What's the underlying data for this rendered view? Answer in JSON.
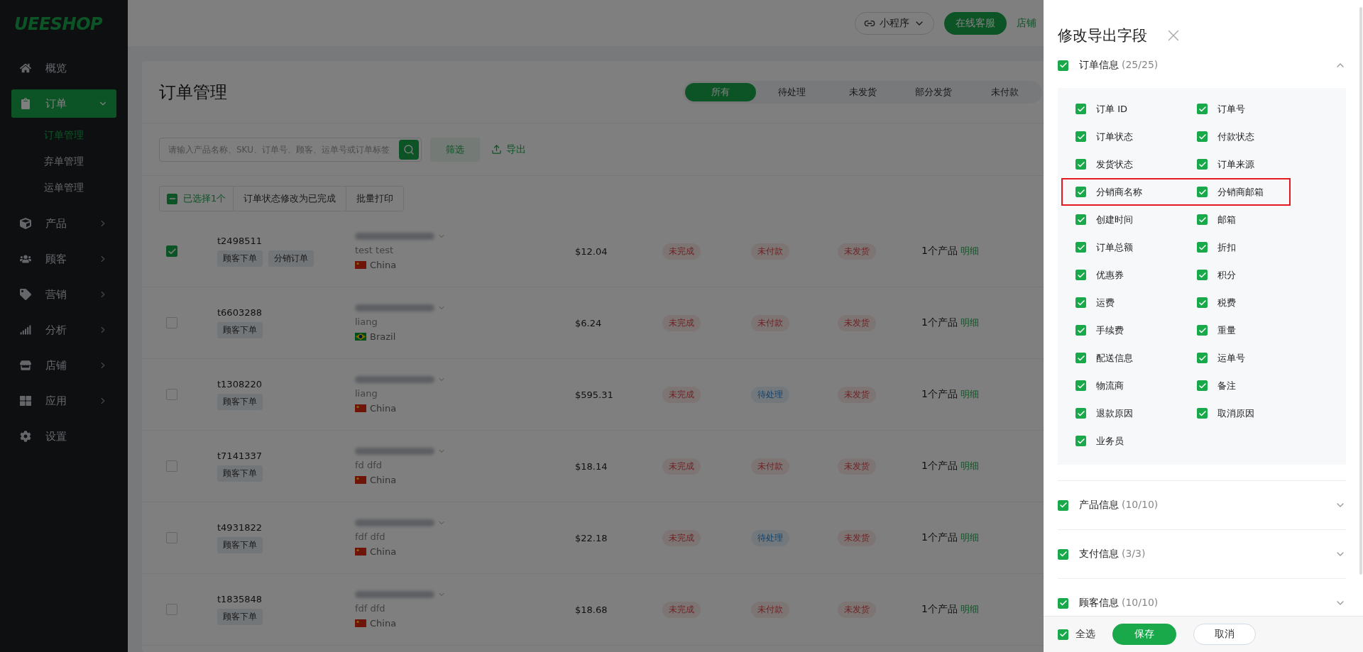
{
  "sidebar": {
    "logo": "UEESHOP",
    "items": [
      {
        "label": "概览",
        "selected": false
      },
      {
        "label": "订单",
        "selected": true,
        "expanded": true,
        "children": [
          {
            "label": "订单管理",
            "selected": true
          },
          {
            "label": "弃单管理",
            "selected": false
          },
          {
            "label": "运单管理",
            "selected": false
          }
        ]
      },
      {
        "label": "产品",
        "selected": false,
        "expanded": false
      },
      {
        "label": "顾客",
        "selected": false,
        "expanded": false
      },
      {
        "label": "营销",
        "selected": false,
        "expanded": false
      },
      {
        "label": "分析",
        "selected": false,
        "expanded": false
      },
      {
        "label": "店铺",
        "selected": false,
        "expanded": false
      },
      {
        "label": "应用",
        "selected": false,
        "expanded": false
      },
      {
        "label": "设置",
        "selected": false
      }
    ]
  },
  "header": {
    "mini_program": "小程序",
    "support_button": "在线客服",
    "store_link": "店铺"
  },
  "page": {
    "title": "订单管理",
    "tabs": [
      {
        "label": "所有",
        "selected": true
      },
      {
        "label": "待处理",
        "selected": false
      },
      {
        "label": "未发货",
        "selected": false
      },
      {
        "label": "部分发货",
        "selected": false
      },
      {
        "label": "未付款",
        "selected": false
      }
    ],
    "search": {
      "placeholder": "请输入产品名称、SKU、订单号、顾客、运单号或订单标签"
    },
    "filter_button": "筛选",
    "export_link": "导出",
    "bulk": {
      "indeterminate": true,
      "selected_text": "已选择1个",
      "actions": [
        "订单状态修改为已完成",
        "批量打印"
      ]
    },
    "orders": [
      {
        "selected": true,
        "number": "t2498511",
        "tags": [
          "顾客下单",
          "分销订单"
        ],
        "customer": "test test",
        "country": "China",
        "total": "$12.04",
        "statuses": [
          {
            "label": "未完成",
            "kind": "danger"
          },
          {
            "label": "未付款",
            "kind": "danger"
          },
          {
            "label": "未发货",
            "kind": "danger"
          }
        ],
        "products": "1个产品",
        "detail_link": "明细"
      },
      {
        "selected": false,
        "number": "t6603288",
        "tags": [
          "顾客下单"
        ],
        "customer": "liang",
        "country": "Brazil",
        "total": "$6.24",
        "statuses": [
          {
            "label": "未完成",
            "kind": "danger"
          },
          {
            "label": "未付款",
            "kind": "danger"
          },
          {
            "label": "未发货",
            "kind": "danger"
          }
        ],
        "products": "1个产品",
        "detail_link": "明细"
      },
      {
        "selected": false,
        "number": "t1308220",
        "tags": [
          "顾客下单"
        ],
        "customer": "liang",
        "country": "China",
        "total": "$595.31",
        "statuses": [
          {
            "label": "未完成",
            "kind": "danger"
          },
          {
            "label": "待处理",
            "kind": "info"
          },
          {
            "label": "未发货",
            "kind": "danger"
          }
        ],
        "products": "1个产品",
        "detail_link": "明细"
      },
      {
        "selected": false,
        "number": "t7141337",
        "tags": [
          "顾客下单"
        ],
        "customer": "fd dfd",
        "country": "China",
        "total": "$18.14",
        "statuses": [
          {
            "label": "未完成",
            "kind": "danger"
          },
          {
            "label": "未付款",
            "kind": "danger"
          },
          {
            "label": "未发货",
            "kind": "danger"
          }
        ],
        "products": "1个产品",
        "detail_link": "明细"
      },
      {
        "selected": false,
        "number": "t4931822",
        "tags": [
          "顾客下单"
        ],
        "customer": "fdf dfd",
        "country": "China",
        "total": "$22.18",
        "statuses": [
          {
            "label": "未完成",
            "kind": "danger"
          },
          {
            "label": "待处理",
            "kind": "info"
          },
          {
            "label": "未发货",
            "kind": "danger"
          }
        ],
        "products": "1个产品",
        "detail_link": "明细"
      },
      {
        "selected": false,
        "number": "t1835848",
        "tags": [
          "顾客下单"
        ],
        "customer": "fdf dfd",
        "country": "China",
        "total": "$18.68",
        "statuses": [
          {
            "label": "未完成",
            "kind": "danger"
          },
          {
            "label": "未付款",
            "kind": "danger"
          },
          {
            "label": "未发货",
            "kind": "danger"
          }
        ],
        "products": "1个产品",
        "detail_link": "明细"
      }
    ]
  },
  "drawer": {
    "title": "修改导出字段",
    "sections": [
      {
        "title": "订单信息",
        "count": "(25/25)",
        "checked": true,
        "expanded": true,
        "rows": [
          {
            "highlighted": false,
            "fields": [
              {
                "label": "订单 ID",
                "checked": true
              },
              {
                "label": "订单号",
                "checked": true
              }
            ]
          },
          {
            "highlighted": false,
            "fields": [
              {
                "label": "订单状态",
                "checked": true
              },
              {
                "label": "付款状态",
                "checked": true
              }
            ]
          },
          {
            "highlighted": false,
            "fields": [
              {
                "label": "发货状态",
                "checked": true
              },
              {
                "label": "订单来源",
                "checked": true
              }
            ]
          },
          {
            "highlighted": true,
            "fields": [
              {
                "label": "分销商名称",
                "checked": true
              },
              {
                "label": "分销商邮箱",
                "checked": true
              }
            ]
          },
          {
            "highlighted": false,
            "fields": [
              {
                "label": "创建时间",
                "checked": true
              },
              {
                "label": "邮箱",
                "checked": true
              }
            ]
          },
          {
            "highlighted": false,
            "fields": [
              {
                "label": "订单总额",
                "checked": true
              },
              {
                "label": "折扣",
                "checked": true
              }
            ]
          },
          {
            "highlighted": false,
            "fields": [
              {
                "label": "优惠券",
                "checked": true
              },
              {
                "label": "积分",
                "checked": true
              }
            ]
          },
          {
            "highlighted": false,
            "fields": [
              {
                "label": "运费",
                "checked": true
              },
              {
                "label": "税费",
                "checked": true
              }
            ]
          },
          {
            "highlighted": false,
            "fields": [
              {
                "label": "手续费",
                "checked": true
              },
              {
                "label": "重量",
                "checked": true
              }
            ]
          },
          {
            "highlighted": false,
            "fields": [
              {
                "label": "配送信息",
                "checked": true
              },
              {
                "label": "运单号",
                "checked": true
              }
            ]
          },
          {
            "highlighted": false,
            "fields": [
              {
                "label": "物流商",
                "checked": true
              },
              {
                "label": "备注",
                "checked": true
              }
            ]
          },
          {
            "highlighted": false,
            "fields": [
              {
                "label": "退款原因",
                "checked": true
              },
              {
                "label": "取消原因",
                "checked": true
              }
            ]
          },
          {
            "highlighted": false,
            "fields": [
              {
                "label": "业务员",
                "checked": true
              }
            ]
          }
        ]
      },
      {
        "title": "产品信息",
        "count": "(10/10)",
        "checked": true,
        "expanded": false
      },
      {
        "title": "支付信息",
        "count": "(3/3)",
        "checked": true,
        "expanded": false
      },
      {
        "title": "顾客信息",
        "count": "(10/10)",
        "checked": true,
        "expanded": false
      }
    ],
    "select_all": {
      "label": "全选",
      "checked": true
    },
    "save_button": "保存",
    "cancel_button": "取消"
  }
}
